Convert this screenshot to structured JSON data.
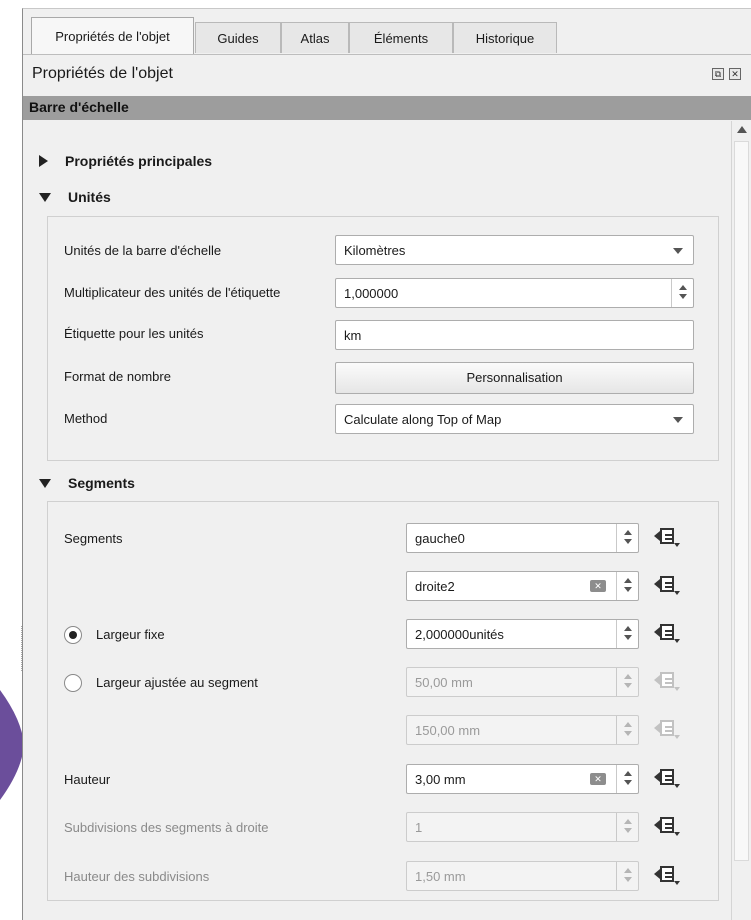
{
  "tabs": [
    {
      "label": "Propriétés de l'objet",
      "active": true
    },
    {
      "label": "Guides",
      "active": false
    },
    {
      "label": "Atlas",
      "active": false
    },
    {
      "label": "Éléments",
      "active": false
    },
    {
      "label": "Historique",
      "active": false
    }
  ],
  "panel": {
    "title": "Propriétés de l'objet"
  },
  "section": {
    "title": "Barre d'échelle"
  },
  "groups": {
    "main_props": {
      "title": "Propriétés principales",
      "expanded": false
    },
    "units": {
      "title": "Unités",
      "expanded": true,
      "bar_units_label": "Unités de la barre d'échelle",
      "bar_units_value": "Kilomètres",
      "multiplier_label": "Multiplicateur des unités de l'étiquette",
      "multiplier_value": "1,000000",
      "unit_label_label": "Étiquette pour les unités",
      "unit_label_value": "km",
      "number_format_label": "Format de nombre",
      "number_format_button": "Personnalisation",
      "method_label": "Method",
      "method_value": "Calculate along Top of Map"
    },
    "segments": {
      "title": "Segments",
      "expanded": true,
      "segments_label": "Segments",
      "left_value": "gauche0",
      "right_value": "droite2",
      "fixed_width_label": "Largeur fixe",
      "fixed_width_selected": true,
      "fixed_width_value": "2,000000unités",
      "fit_width_label": "Largeur ajustée au segment",
      "fit_width_selected": false,
      "fit_min_value": "50,00 mm",
      "fit_max_value": "150,00 mm",
      "height_label": "Hauteur",
      "height_value": "3,00 mm",
      "subdivisions_label": "Subdivisions des segments à droite",
      "subdivisions_value": "1",
      "subdivision_height_label": "Hauteur des subdivisions",
      "subdivision_height_value": "1,50 mm"
    }
  },
  "icons": {
    "data_defined": "data-defined-override-icon",
    "clear": "clear-icon",
    "float": "float-icon",
    "close": "close-icon"
  },
  "colors": {
    "section_bar": "#9d9d9d",
    "panel_bg": "#f0f0f0",
    "accent_purple": "#6b4e9b"
  }
}
